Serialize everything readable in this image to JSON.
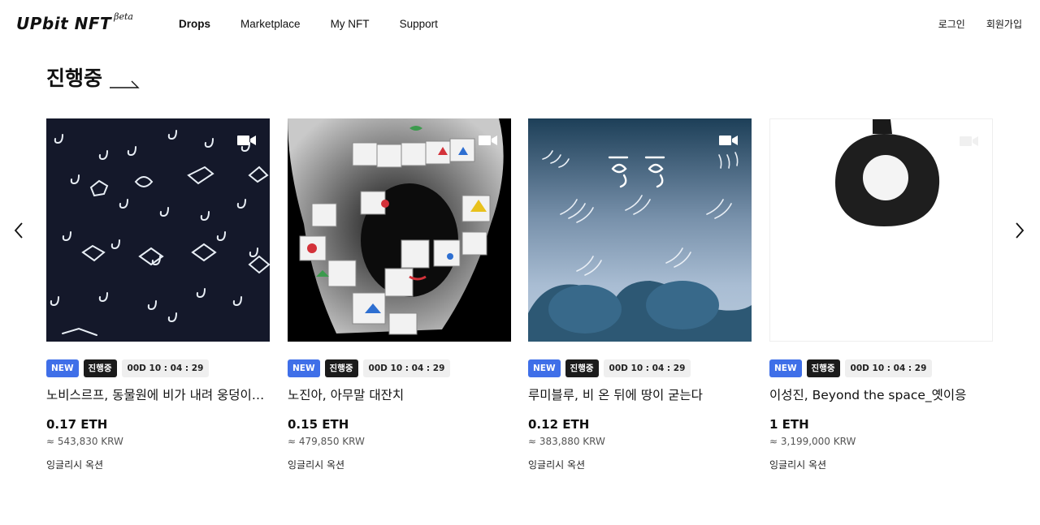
{
  "header": {
    "logo": "UPbit NFT",
    "logo_beta": "βeta",
    "nav": [
      "Drops",
      "Marketplace",
      "My NFT",
      "Support"
    ],
    "auth": {
      "login": "로그인",
      "signup": "회원가입"
    }
  },
  "section": {
    "title": "진행중"
  },
  "cards": [
    {
      "badge_new": "NEW",
      "badge_status": "진행중",
      "time_left": "00D  10 : 04 : 29",
      "title": "노비스르프, 동물원에 비가 내려 웅덩이가 생겼다",
      "price": "0.17 ETH",
      "krw": "≈ 543,830 KRW",
      "auction_type": "잉글리시 옥션",
      "video_icon": "video-camera-icon"
    },
    {
      "badge_new": "NEW",
      "badge_status": "진행중",
      "time_left": "00D  10 : 04 : 29",
      "title": "노진아, 아무말 대잔치",
      "price": "0.15 ETH",
      "krw": "≈ 479,850 KRW",
      "auction_type": "잉글리시 옥션",
      "video_icon": "video-camera-icon"
    },
    {
      "badge_new": "NEW",
      "badge_status": "진행중",
      "time_left": "00D  10 : 04 : 29",
      "title": "루미블루, 비 온 뒤에 땅이 굳는다",
      "price": "0.12 ETH",
      "krw": "≈ 383,880 KRW",
      "auction_type": "잉글리시 옥션",
      "video_icon": "video-camera-icon"
    },
    {
      "badge_new": "NEW",
      "badge_status": "진행중",
      "time_left": "00D  10 : 04 : 29",
      "title": "이성진, Beyond the space_옛이응",
      "price": "1 ETH",
      "krw": "≈ 3,199,000 KRW",
      "auction_type": "잉글리시 옥션",
      "video_icon": "video-camera-icon"
    }
  ],
  "colors": {
    "new_badge": "#3f6fe8",
    "status_badge": "#1b1b1b",
    "time_badge": "#efefef"
  }
}
